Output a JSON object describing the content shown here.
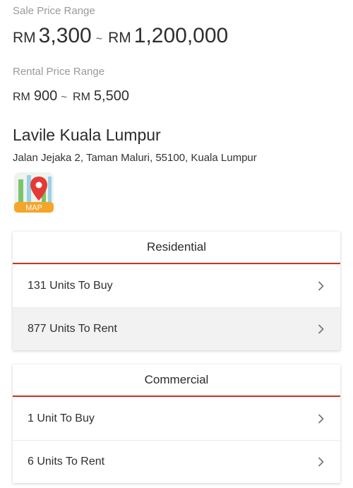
{
  "sale": {
    "label": "Sale Price Range",
    "currency": "RM",
    "min": "3,300",
    "separator": "~",
    "max": "1,200,000"
  },
  "rental": {
    "label": "Rental Price Range",
    "currency": "RM",
    "min": "900",
    "separator": "~",
    "max": "5,500"
  },
  "project": {
    "name": "Lavile Kuala Lumpur",
    "address": "Jalan Jejaka 2, Taman Maluri, 55100, Kuala Lumpur",
    "map_label": "MAP",
    "map_icon": "map-pin-icon"
  },
  "residential": {
    "title": "Residential",
    "rows": [
      {
        "label": "131 Units To Buy",
        "icon": "chevron-right-icon"
      },
      {
        "label": "877 Units To Rent",
        "icon": "chevron-right-icon"
      }
    ]
  },
  "commercial": {
    "title": "Commercial",
    "rows": [
      {
        "label": "1 Unit To Buy",
        "icon": "chevron-right-icon"
      },
      {
        "label": "6 Units To Rent",
        "icon": "chevron-right-icon"
      }
    ]
  },
  "colors": {
    "accent": "#c0392b",
    "muted_text": "#9a9a9a",
    "row_shade": "#f2f2f2",
    "map_badge": "#f4a62a"
  }
}
